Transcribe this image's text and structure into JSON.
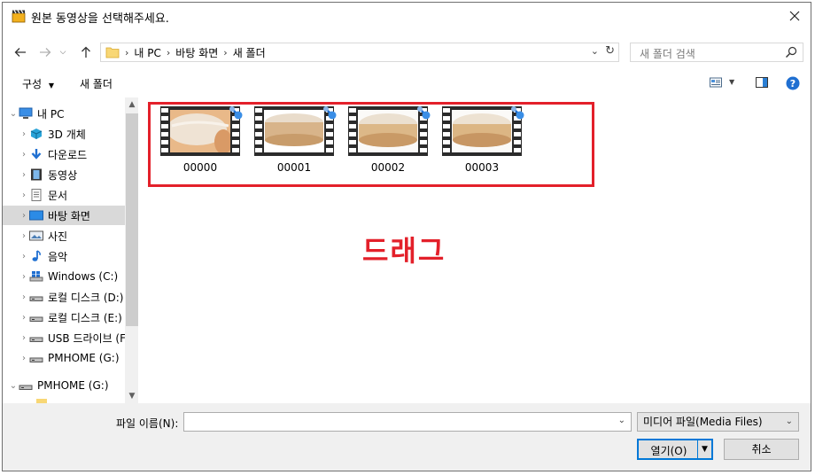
{
  "window": {
    "title": "원본 동영상을 선택해주세요."
  },
  "nav": {
    "address": [
      "내 PC",
      "바탕 화면",
      "새 폴더"
    ],
    "search_placeholder": "새 폴더 검색"
  },
  "toolbar": {
    "organize": "구성",
    "new_folder": "새 폴더"
  },
  "sidebar": {
    "items": [
      {
        "label": "내 PC",
        "icon": "pc-icon",
        "expanded": true,
        "depth": 0
      },
      {
        "label": "3D 개체",
        "icon": "3d-objects-icon",
        "depth": 1
      },
      {
        "label": "다운로드",
        "icon": "download-icon",
        "depth": 1
      },
      {
        "label": "동영상",
        "icon": "videos-icon",
        "depth": 1
      },
      {
        "label": "문서",
        "icon": "documents-icon",
        "depth": 1
      },
      {
        "label": "바탕 화면",
        "icon": "desktop-icon",
        "depth": 1,
        "selected": true
      },
      {
        "label": "사진",
        "icon": "pictures-icon",
        "depth": 1
      },
      {
        "label": "음악",
        "icon": "music-icon",
        "depth": 1
      },
      {
        "label": "Windows (C:)",
        "icon": "windows-drive-icon",
        "depth": 1
      },
      {
        "label": "로컬 디스크 (D:)",
        "icon": "drive-icon",
        "depth": 1
      },
      {
        "label": "로컬 디스크 (E:)",
        "icon": "drive-icon",
        "depth": 1
      },
      {
        "label": "USB 드라이브 (F:)",
        "icon": "usb-drive-icon",
        "depth": 1
      },
      {
        "label": "PMHOME (G:)",
        "icon": "drive-icon",
        "depth": 1
      },
      {
        "label": "PMHOME (G:)",
        "icon": "drive-icon",
        "depth": 0,
        "expanded": true
      }
    ]
  },
  "files": [
    {
      "name": "00000"
    },
    {
      "name": "00001"
    },
    {
      "name": "00002"
    },
    {
      "name": "00003"
    }
  ],
  "annotation": {
    "text": "드래그",
    "color": "#e3202a"
  },
  "bottom": {
    "filename_label": "파일 이름(N):",
    "filename_value": "",
    "filetype": "미디어 파일(Media Files)",
    "open_label": "열기(O)",
    "cancel_label": "취소"
  },
  "colors": {
    "accent": "#0078d7",
    "selection": "#d9d9d9",
    "highlight": "#e3202a"
  }
}
